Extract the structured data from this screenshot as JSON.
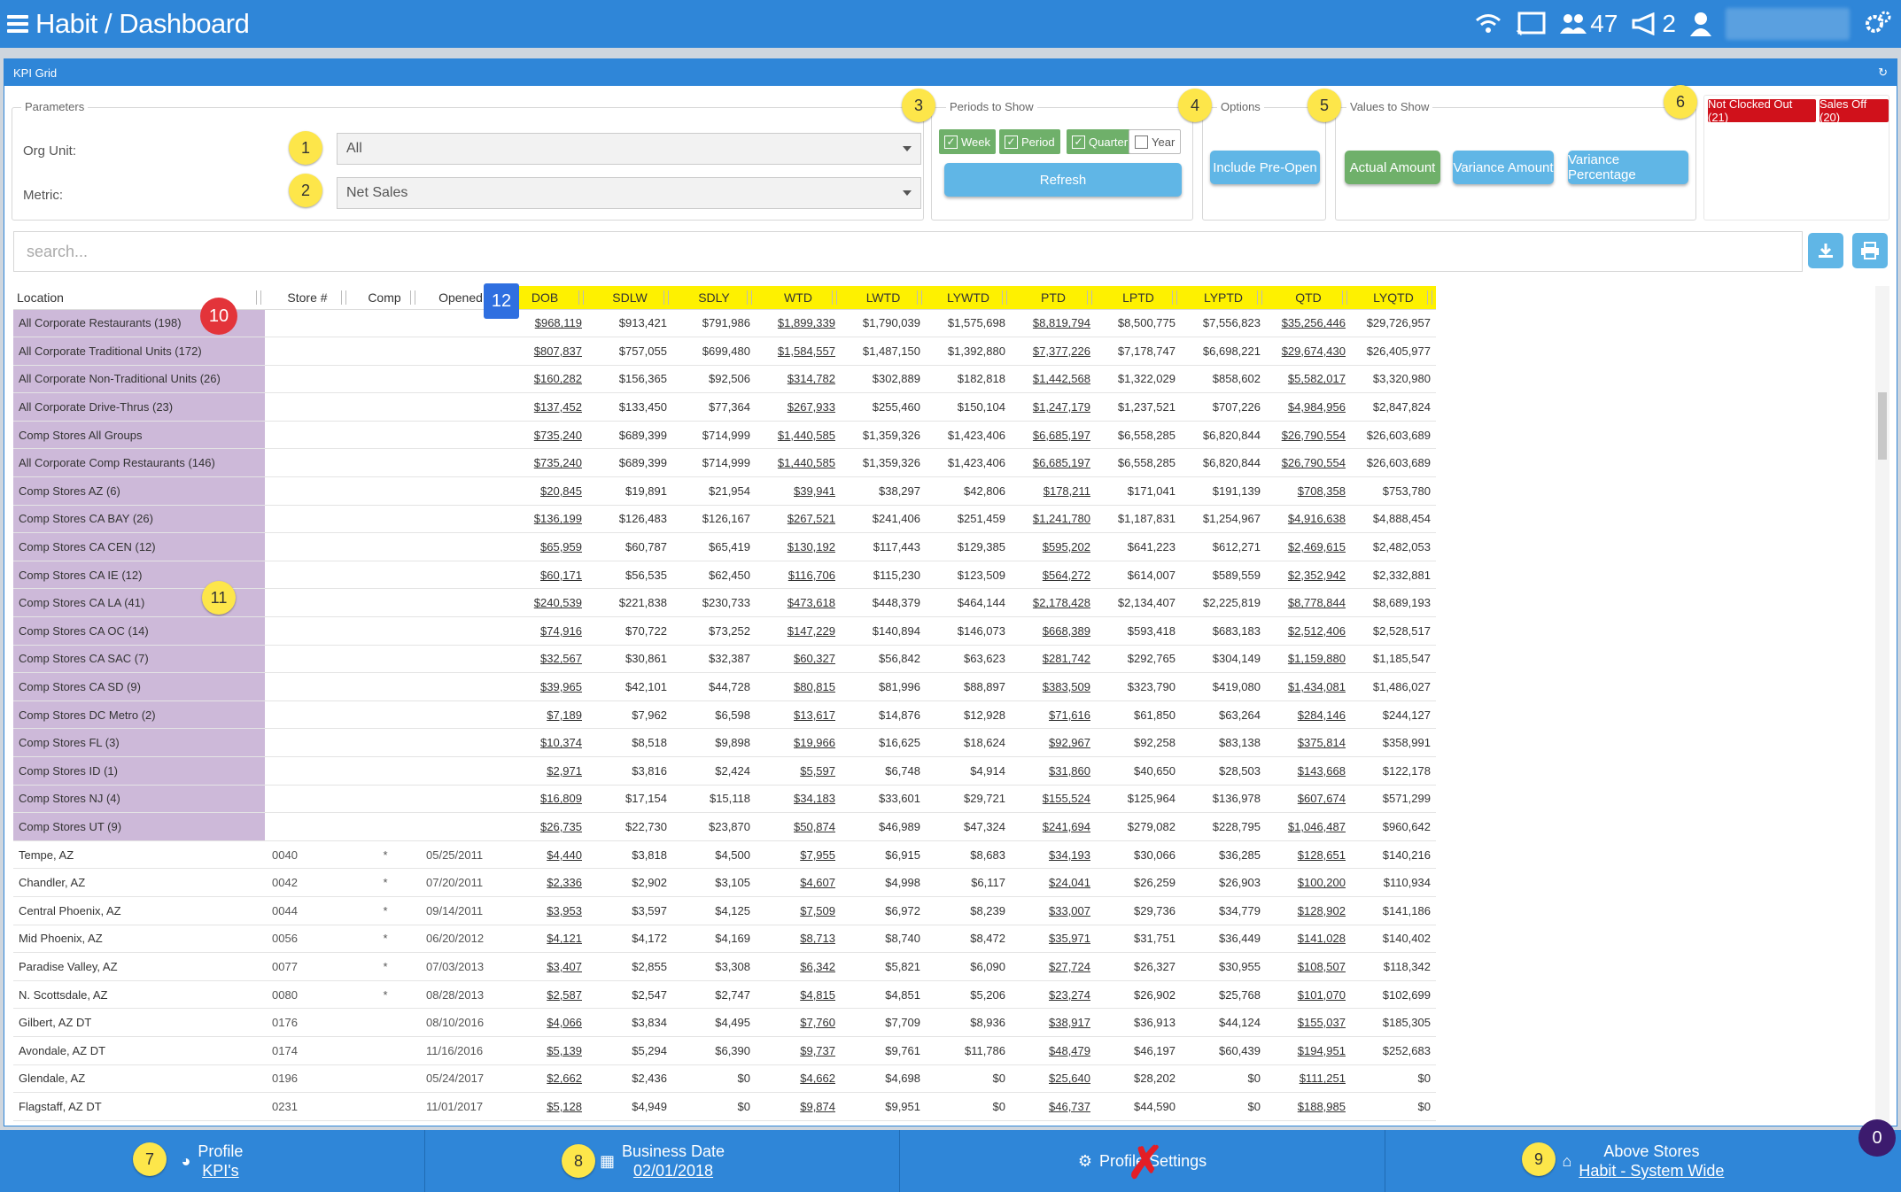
{
  "app": {
    "title": "Habit / Dashboard",
    "people_count": "47",
    "notif_count": "2"
  },
  "panel": {
    "title": "KPI Grid"
  },
  "params": {
    "legend": "Parameters",
    "org_unit_label": "Org Unit:",
    "org_unit_value": "All",
    "metric_label": "Metric:",
    "metric_value": "Net Sales"
  },
  "periods": {
    "legend": "Periods to Show",
    "week": "Week",
    "period": "Period",
    "quarter": "Quarter",
    "year": "Year",
    "refresh": "Refresh"
  },
  "options": {
    "legend": "Options",
    "include_pre_open": "Include Pre-Open"
  },
  "values": {
    "legend": "Values to Show",
    "actual": "Actual Amount",
    "variance_amount": "Variance Amount",
    "variance_pct": "Variance Percentage"
  },
  "alerts": {
    "not_clocked_out": "Not Clocked Out (21)",
    "sales_off": "Sales Off (20)"
  },
  "search": {
    "placeholder": "search..."
  },
  "grid": {
    "headers": [
      "Location",
      "Store #",
      "Comp",
      "Opened",
      "DOB",
      "SDLW",
      "SDLY",
      "WTD",
      "LWTD",
      "LYWTD",
      "PTD",
      "LPTD",
      "LYPTD",
      "QTD",
      "LYQTD"
    ],
    "groups": [
      [
        "All Corporate Restaurants (198)",
        "$968,119",
        "$913,421",
        "$791,986",
        "$1,899,339",
        "$1,790,039",
        "$1,575,698",
        "$8,819,794",
        "$8,500,775",
        "$7,556,823",
        "$35,256,446",
        "$29,726,957"
      ],
      [
        "All Corporate Traditional Units (172)",
        "$807,837",
        "$757,055",
        "$699,480",
        "$1,584,557",
        "$1,487,150",
        "$1,392,880",
        "$7,377,226",
        "$7,178,747",
        "$6,698,221",
        "$29,674,430",
        "$26,405,977"
      ],
      [
        "All Corporate Non-Traditional Units (26)",
        "$160,282",
        "$156,365",
        "$92,506",
        "$314,782",
        "$302,889",
        "$182,818",
        "$1,442,568",
        "$1,322,029",
        "$858,602",
        "$5,582,017",
        "$3,320,980"
      ],
      [
        "All Corporate Drive-Thrus (23)",
        "$137,452",
        "$133,450",
        "$77,364",
        "$267,933",
        "$255,460",
        "$150,104",
        "$1,247,179",
        "$1,237,521",
        "$707,226",
        "$4,984,956",
        "$2,847,824"
      ],
      [
        "Comp Stores All Groups",
        "$735,240",
        "$689,399",
        "$714,999",
        "$1,440,585",
        "$1,359,326",
        "$1,423,406",
        "$6,685,197",
        "$6,558,285",
        "$6,820,844",
        "$26,790,554",
        "$26,603,689"
      ],
      [
        "All Corporate Comp Restaurants (146)",
        "$735,240",
        "$689,399",
        "$714,999",
        "$1,440,585",
        "$1,359,326",
        "$1,423,406",
        "$6,685,197",
        "$6,558,285",
        "$6,820,844",
        "$26,790,554",
        "$26,603,689"
      ],
      [
        "Comp Stores AZ (6)",
        "$20,845",
        "$19,891",
        "$21,954",
        "$39,941",
        "$38,297",
        "$42,806",
        "$178,211",
        "$171,041",
        "$191,139",
        "$708,358",
        "$753,780"
      ],
      [
        "Comp Stores CA BAY (26)",
        "$136,199",
        "$126,483",
        "$126,167",
        "$267,521",
        "$241,406",
        "$251,459",
        "$1,241,780",
        "$1,187,831",
        "$1,254,967",
        "$4,916,638",
        "$4,888,454"
      ],
      [
        "Comp Stores CA CEN (12)",
        "$65,959",
        "$60,787",
        "$65,419",
        "$130,192",
        "$117,443",
        "$129,385",
        "$595,202",
        "$641,223",
        "$612,271",
        "$2,469,615",
        "$2,482,053"
      ],
      [
        "Comp Stores CA IE (12)",
        "$60,171",
        "$56,535",
        "$62,450",
        "$116,706",
        "$115,230",
        "$123,509",
        "$564,272",
        "$614,007",
        "$589,559",
        "$2,352,942",
        "$2,332,881"
      ],
      [
        "Comp Stores CA LA (41)",
        "$240,539",
        "$221,838",
        "$230,733",
        "$473,618",
        "$448,379",
        "$464,144",
        "$2,178,428",
        "$2,134,407",
        "$2,225,819",
        "$8,778,844",
        "$8,689,193"
      ],
      [
        "Comp Stores CA OC (14)",
        "$74,916",
        "$70,722",
        "$73,252",
        "$147,229",
        "$140,894",
        "$146,073",
        "$668,389",
        "$593,418",
        "$683,183",
        "$2,512,406",
        "$2,528,517"
      ],
      [
        "Comp Stores CA SAC (7)",
        "$32,567",
        "$30,861",
        "$32,387",
        "$60,327",
        "$56,842",
        "$63,623",
        "$281,742",
        "$292,765",
        "$304,149",
        "$1,159,880",
        "$1,185,547"
      ],
      [
        "Comp Stores CA SD (9)",
        "$39,965",
        "$42,101",
        "$44,728",
        "$80,815",
        "$81,996",
        "$88,897",
        "$383,509",
        "$323,790",
        "$419,080",
        "$1,434,081",
        "$1,486,027"
      ],
      [
        "Comp Stores DC Metro (2)",
        "$7,189",
        "$7,962",
        "$6,598",
        "$13,617",
        "$14,876",
        "$12,928",
        "$71,616",
        "$61,850",
        "$63,264",
        "$284,146",
        "$244,127"
      ],
      [
        "Comp Stores FL (3)",
        "$10,374",
        "$8,518",
        "$9,898",
        "$19,966",
        "$16,625",
        "$18,624",
        "$92,967",
        "$92,258",
        "$83,138",
        "$375,814",
        "$358,991"
      ],
      [
        "Comp Stores ID (1)",
        "$2,971",
        "$3,816",
        "$2,424",
        "$5,597",
        "$6,748",
        "$4,914",
        "$31,860",
        "$40,650",
        "$28,503",
        "$143,668",
        "$122,178"
      ],
      [
        "Comp Stores NJ (4)",
        "$16,809",
        "$17,154",
        "$15,118",
        "$34,183",
        "$33,601",
        "$29,721",
        "$155,524",
        "$125,964",
        "$136,978",
        "$607,674",
        "$571,299"
      ],
      [
        "Comp Stores UT (9)",
        "$26,735",
        "$22,730",
        "$23,870",
        "$50,874",
        "$46,989",
        "$47,324",
        "$241,694",
        "$279,082",
        "$228,795",
        "$1,046,487",
        "$960,642"
      ]
    ],
    "stores": [
      [
        "Tempe, AZ",
        "0040",
        "*",
        "05/25/2011",
        "$4,440",
        "$3,818",
        "$4,500",
        "$7,955",
        "$6,915",
        "$8,683",
        "$34,193",
        "$30,066",
        "$36,285",
        "$128,651",
        "$140,216"
      ],
      [
        "Chandler, AZ",
        "0042",
        "*",
        "07/20/2011",
        "$2,336",
        "$2,902",
        "$3,105",
        "$4,607",
        "$4,998",
        "$6,117",
        "$24,041",
        "$26,259",
        "$26,903",
        "$100,200",
        "$110,934"
      ],
      [
        "Central Phoenix, AZ",
        "0044",
        "*",
        "09/14/2011",
        "$3,953",
        "$3,597",
        "$4,125",
        "$7,509",
        "$6,972",
        "$8,239",
        "$33,007",
        "$29,736",
        "$34,779",
        "$128,902",
        "$141,186"
      ],
      [
        "Mid Phoenix, AZ",
        "0056",
        "*",
        "06/20/2012",
        "$4,121",
        "$4,172",
        "$4,169",
        "$8,713",
        "$8,740",
        "$8,472",
        "$35,971",
        "$31,751",
        "$36,449",
        "$141,028",
        "$140,402"
      ],
      [
        "Paradise Valley, AZ",
        "0077",
        "*",
        "07/03/2013",
        "$3,407",
        "$2,855",
        "$3,308",
        "$6,342",
        "$5,821",
        "$6,090",
        "$27,724",
        "$26,327",
        "$30,955",
        "$108,507",
        "$118,342"
      ],
      [
        "N. Scottsdale, AZ",
        "0080",
        "*",
        "08/28/2013",
        "$2,587",
        "$2,547",
        "$2,747",
        "$4,815",
        "$4,851",
        "$5,206",
        "$23,274",
        "$26,902",
        "$25,768",
        "$101,070",
        "$102,699"
      ],
      [
        "Gilbert, AZ DT",
        "0176",
        "",
        "08/10/2016",
        "$4,066",
        "$3,834",
        "$4,495",
        "$7,760",
        "$7,709",
        "$8,936",
        "$38,917",
        "$36,913",
        "$44,124",
        "$155,037",
        "$185,305"
      ],
      [
        "Avondale, AZ DT",
        "0174",
        "",
        "11/16/2016",
        "$5,139",
        "$5,294",
        "$6,390",
        "$9,737",
        "$9,761",
        "$11,786",
        "$48,479",
        "$46,197",
        "$60,439",
        "$194,951",
        "$252,683"
      ],
      [
        "Glendale, AZ",
        "0196",
        "",
        "05/24/2017",
        "$2,662",
        "$2,436",
        "$0",
        "$4,662",
        "$4,698",
        "$0",
        "$25,640",
        "$28,202",
        "$0",
        "$111,251",
        "$0"
      ],
      [
        "Flagstaff, AZ DT",
        "0231",
        "",
        "11/01/2017",
        "$5,128",
        "$4,949",
        "$0",
        "$9,874",
        "$9,951",
        "$0",
        "$46,737",
        "$44,590",
        "$0",
        "$188,985",
        "$0"
      ]
    ]
  },
  "footer": {
    "profile_title": "Profile",
    "profile_link": "KPI's",
    "business_date_title": "Business Date",
    "business_date_value": "02/01/2018",
    "profile_settings": "Profile Settings",
    "above_stores_title": "Above Stores",
    "above_stores_link": "Habit - System Wide",
    "badge": "0"
  },
  "markers": [
    "1",
    "2",
    "3",
    "4",
    "5",
    "6",
    "7",
    "8",
    "9",
    "10",
    "11",
    "12"
  ],
  "colors": {
    "primary": "#2f86d8",
    "highlight": "#fef100",
    "group_row": "#cdb9d9",
    "alert": "#d0111b",
    "green": "#6fb06a",
    "light_blue": "#60b6e6"
  }
}
